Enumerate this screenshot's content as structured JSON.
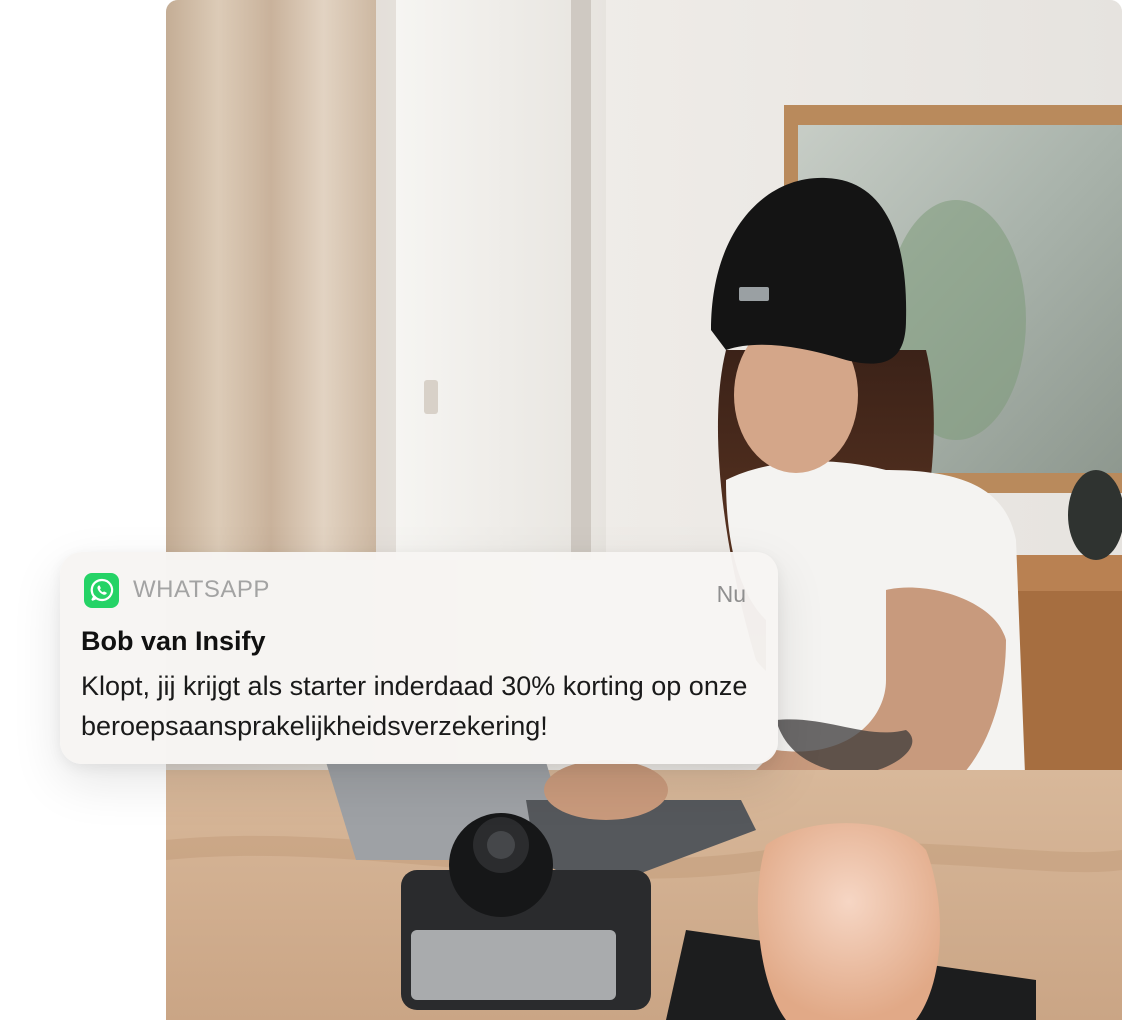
{
  "notification": {
    "app_name": "WHATSAPP",
    "app_icon": "whatsapp-icon",
    "time": "Nu",
    "sender": "Bob van Insify",
    "message": "Klopt, jij krijgt als starter inderdaad 30% korting op onze beroepsaansprakelijkheidsverzekering!"
  },
  "colors": {
    "whatsapp_green": "#25d366"
  }
}
